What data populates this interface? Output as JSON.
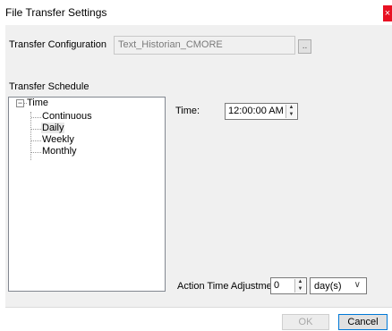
{
  "window": {
    "title": "File Transfer Settings",
    "close_glyph": "×"
  },
  "transfer_configuration": {
    "label": "Transfer Configuration",
    "value": "Text_Historian_CMORE",
    "browse_label": ".."
  },
  "transfer_schedule": {
    "label": "Transfer Schedule",
    "tree": {
      "root": {
        "label": "Time",
        "expander": "−"
      },
      "children": [
        {
          "label": "Continuous",
          "selected": false
        },
        {
          "label": "Daily",
          "selected": true
        },
        {
          "label": "Weekly",
          "selected": false
        },
        {
          "label": "Monthly",
          "selected": false
        }
      ]
    }
  },
  "time": {
    "label": "Time:",
    "value": "12:00:00 AM",
    "spin_up": "▲",
    "spin_down": "▼"
  },
  "action_time_adjustment": {
    "label": "Action Time Adjustment:",
    "value": "0",
    "spin_up": "▲",
    "spin_down": "▼",
    "unit_selected": "day(s)",
    "unit_arrow": "∨"
  },
  "buttons": {
    "ok": "OK",
    "cancel": "Cancel"
  },
  "icons": {
    "close": "close-icon",
    "expander": "tree-collapse-icon",
    "dropdown": "chevron-down-icon"
  },
  "colors": {
    "close_button": "#e81123",
    "dialog_background": "#f0f0f0",
    "focus_border": "#0078d7"
  }
}
